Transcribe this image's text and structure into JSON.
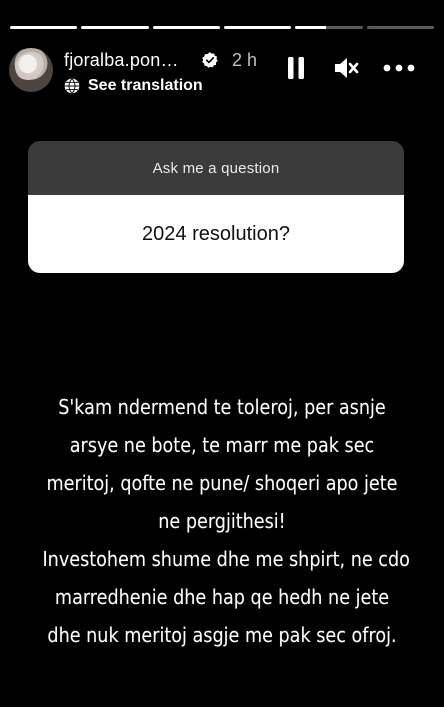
{
  "progress": [
    1,
    1,
    1,
    1,
    0.45,
    0
  ],
  "header": {
    "username": "fjoralba.pon…",
    "time": "2 h",
    "translate_label": "See translation"
  },
  "icons": {
    "verified": "verified-badge-icon",
    "globe": "globe-icon",
    "pause": "pause-icon",
    "mute": "speaker-muted-icon",
    "more": "more-horizontal-icon"
  },
  "question": {
    "prompt": "Ask me a question",
    "answer": "2024 resolution?"
  },
  "story_text": {
    "lines": [
      "S'kam ndermend te toleroj, per asnje",
      "arsye ne bote, te marr me pak sec",
      "meritoj, qofte ne pune/ shoqeri apo jete",
      "ne pergjithesi!",
      "Investohem shume dhe me shpirt, ne cdo",
      "marredhenie dhe hap qe hedh ne jete",
      "dhe nuk meritoj asgje me pak sec ofroj."
    ]
  },
  "colors": {
    "background": "#000000",
    "card_header": "#3b3b3b",
    "card_body": "#ffffff"
  }
}
